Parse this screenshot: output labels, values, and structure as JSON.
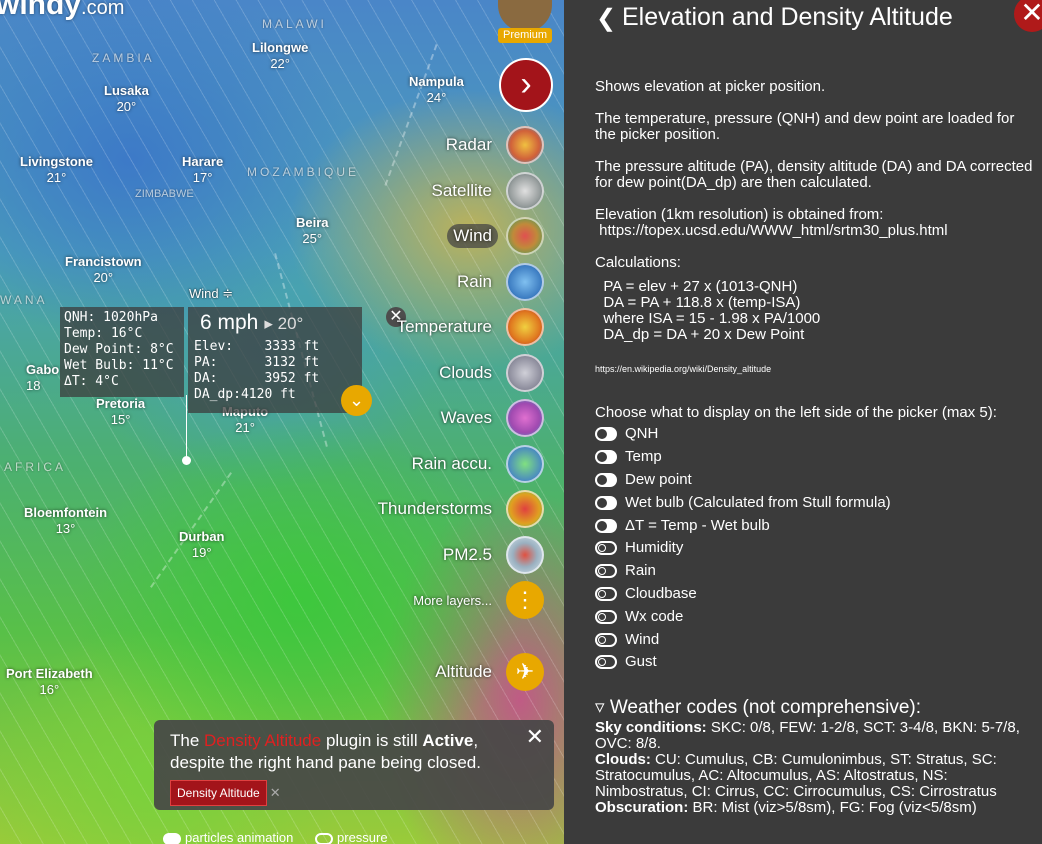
{
  "app": {
    "logo": "windy",
    "logo_suffix": ".com"
  },
  "map": {
    "cities": [
      {
        "name": "Lilongwe",
        "temp": "22°"
      },
      {
        "name": "Lusaka",
        "temp": "20°"
      },
      {
        "name": "Nampula",
        "temp": "24°"
      },
      {
        "name": "Livingstone",
        "temp": "21°"
      },
      {
        "name": "Harare",
        "temp": "17°"
      },
      {
        "name": "Beira",
        "temp": "25°"
      },
      {
        "name": "Francistown",
        "temp": "20°"
      },
      {
        "name": "Pretoria",
        "temp": "15°"
      },
      {
        "name": "Maputo",
        "temp": "21°"
      },
      {
        "name": "Bloemfontein",
        "temp": "13°"
      },
      {
        "name": "Durban",
        "temp": "19°"
      },
      {
        "name": "Port Elizabeth",
        "temp": "16°"
      },
      {
        "name": "Gabo",
        "temp": "18"
      }
    ],
    "countries": {
      "malawi": "MALAWI",
      "zambia": "ZAMBIA",
      "mozambique": "MOZAMBIQUE",
      "zimbabwe": "ZIMBABWE",
      "wana": "WANA",
      "africa": "AFRICA"
    },
    "wind_label": "Wind ≑"
  },
  "picker": {
    "left_lines": [
      "QNH: 1020hPa",
      "Temp: 16°C",
      "Dew Point: 8°C",
      "Wet Bulb: 11°C",
      "ΔT: 4°C"
    ],
    "speed": "6 mph",
    "direction": "▸ 20°",
    "rows": [
      "Elev:    3333 ft",
      "PA:      3132 ft",
      "DA:      3952 ft",
      "DA_dp:4120 ft"
    ],
    "close": "✕",
    "expand": "⌄"
  },
  "layers": [
    {
      "label": "Radar",
      "color": "#d0603a"
    },
    {
      "label": "Satellite",
      "color": "#9aa0a0"
    },
    {
      "label": "Wind",
      "color": "#c08a3a",
      "active": true
    },
    {
      "label": "Rain",
      "color": "#3a7ac0"
    },
    {
      "label": "Temperature",
      "color": "#e07a20"
    },
    {
      "label": "Clouds",
      "color": "#8a8a9a"
    },
    {
      "label": "Waves",
      "color": "#a04ab0"
    },
    {
      "label": "Rain accu.",
      "color": "#4a8ac0"
    },
    {
      "label": "Thunderstorms",
      "color": "#e0a020"
    },
    {
      "label": "PM2.5",
      "color": "#9ab0c0"
    }
  ],
  "more_layers": "More layers...",
  "altitude": "Altitude",
  "premium": "Premium",
  "notice": {
    "pre": "The ",
    "plugin": "Density Altitude",
    "mid": " plugin is still ",
    "active": "Active",
    "post": ",",
    "line2": "despite the right hand pane being closed.",
    "tag": "Density Altitude",
    "tag_x": "✕",
    "close": "✕"
  },
  "bottom": {
    "particles": "particles animation",
    "pressure": "pressure"
  },
  "panel": {
    "title": "Elevation and Density Altitude",
    "back": "❮",
    "close": "✕",
    "p1": "Shows elevation at picker position.",
    "p2": "The temperature, pressure (QNH) and dew point are loaded for the picker position.",
    "p3": "The pressure altitude (PA), density altitude (DA) and DA corrected for dew point(DA_dp) are then calculated.",
    "p4a": "Elevation (1km resolution) is obtained from:",
    "p4b": " https://topex.ucsd.edu/WWW_html/srtm30_plus.html",
    "calc_title": "Calculations:",
    "calc": "  PA = elev + 27 x (1013-QNH)\n  DA = PA + 118.8 x (temp-ISA)\n  where ISA = 15 - 1.98 x PA/1000\n  DA_dp = DA + 20 x Dew Point",
    "link": "https://en.wikipedia.org/wiki/Density_altitude",
    "choose": "Choose what to display on the left side of the picker (max 5):",
    "options": [
      {
        "label": "QNH",
        "on": true
      },
      {
        "label": "Temp",
        "on": true
      },
      {
        "label": "Dew point",
        "on": true
      },
      {
        "label": "Wet bulb (Calculated from Stull formula)",
        "on": true
      },
      {
        "label": "ΔT = Temp - Wet bulb",
        "on": true
      },
      {
        "label": "Humidity",
        "on": false
      },
      {
        "label": "Rain",
        "on": false
      },
      {
        "label": "Cloudbase",
        "on": false
      },
      {
        "label": "Wx code",
        "on": false
      },
      {
        "label": "Wind",
        "on": false
      },
      {
        "label": "Gust",
        "on": false
      }
    ],
    "wx_header": "▿ Weather codes (not comprehensive):",
    "sky_label": "Sky conditions:",
    "sky": " SKC: 0/8, FEW: 1-2/8, SCT: 3-4/8, BKN: 5-7/8, OVC: 8/8.",
    "clouds_label": "Clouds:",
    "clouds": " CU: Cumulus, CB: Cumulonimbus, ST: Stratus, SC: Stratocumulus, AC: Altocumulus, AS: Altostratus, NS: Nimbostratus, CI: Cirrus, CC: Cirrocumulus, CS: Cirrostratus",
    "obsc_label": "Obscuration:",
    "obsc": " BR: Mist (viz>5/8sm), FG: Fog (viz<5/8sm)"
  }
}
